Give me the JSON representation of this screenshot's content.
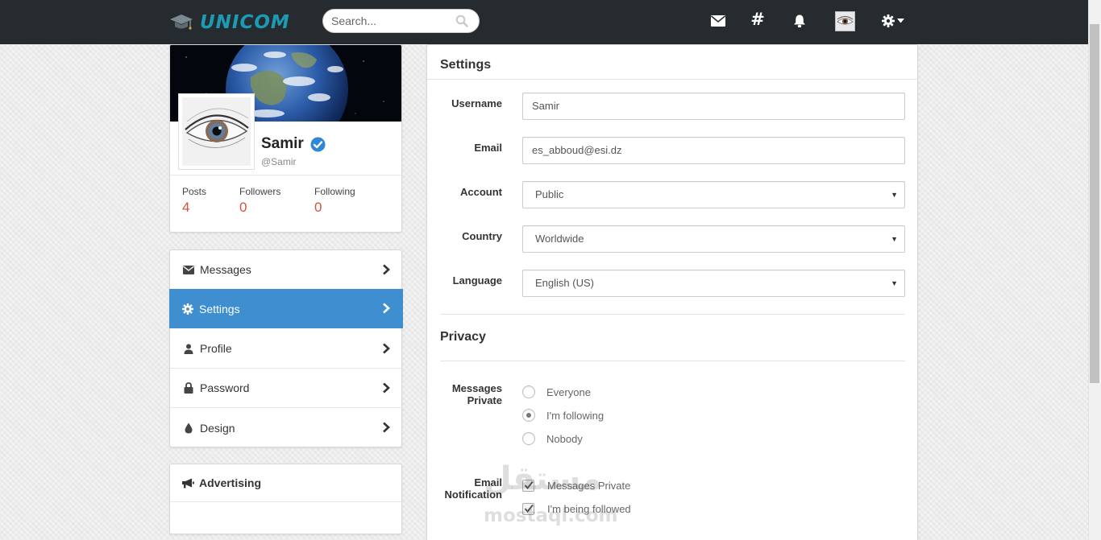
{
  "brand": {
    "name": "UNICOM"
  },
  "search": {
    "placeholder": "Search..."
  },
  "topnav": {
    "icons": [
      "envelope-icon",
      "hashtag-icon",
      "bell-icon",
      "avatar",
      "gear-icon"
    ]
  },
  "profile": {
    "name": "Samir",
    "handle": "@Samir",
    "stats": [
      {
        "label": "Posts",
        "value": "4"
      },
      {
        "label": "Followers",
        "value": "0"
      },
      {
        "label": "Following",
        "value": "0"
      }
    ]
  },
  "sidebar": {
    "items": [
      {
        "label": "Messages",
        "icon": "envelope-icon",
        "active": false
      },
      {
        "label": "Settings",
        "icon": "gear-icon",
        "active": true
      },
      {
        "label": "Profile",
        "icon": "user-icon",
        "active": false
      },
      {
        "label": "Password",
        "icon": "lock-icon",
        "active": false
      },
      {
        "label": "Design",
        "icon": "drop-icon",
        "active": false
      }
    ]
  },
  "ads": {
    "title": "Advertising"
  },
  "settings": {
    "title": "Settings",
    "fields": {
      "username": {
        "label": "Username",
        "value": "Samir"
      },
      "email": {
        "label": "Email",
        "value": "es_abboud@esi.dz"
      },
      "account": {
        "label": "Account",
        "value": "Public"
      },
      "country": {
        "label": "Country",
        "value": "Worldwide"
      },
      "language": {
        "label": "Language",
        "value": "English (US)"
      }
    }
  },
  "privacy": {
    "title": "Privacy",
    "messages_label": "Messages Private",
    "messages_options": [
      {
        "label": "Everyone",
        "checked": false
      },
      {
        "label": "I'm following",
        "checked": true
      },
      {
        "label": "Nobody",
        "checked": false
      }
    ],
    "email_label": "Email Notification",
    "email_options": [
      {
        "label": "Messages Private",
        "checked": true
      },
      {
        "label": "I'm being followed",
        "checked": true
      }
    ]
  },
  "watermark": {
    "arabic": "مستقل",
    "latin": "mostaql.com"
  },
  "colors": {
    "topbar": "#262b2f",
    "accent": "#3f8fd0",
    "stat_value": "#d1543a",
    "brand": "#1f9ab2",
    "verified": "#2f87d6"
  }
}
